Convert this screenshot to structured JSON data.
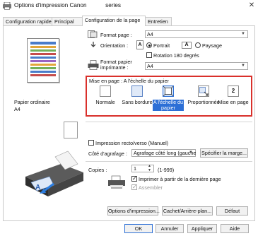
{
  "window": {
    "title": "Options d'impression Canon",
    "title_suffix": "series",
    "close_glyph": "✕",
    "icon": "printer-icon"
  },
  "tabs": [
    {
      "label": "Configuration rapide"
    },
    {
      "label": "Principal"
    },
    {
      "label": "Configuration de la page"
    },
    {
      "label": "Entretien"
    }
  ],
  "preview": {
    "media_type": "Papier ordinaire",
    "media_size": "A4"
  },
  "page_setup": {
    "format_page_label": "Format page :",
    "format_page_value": "A4",
    "orientation_label": "Orientation :",
    "portrait_label": "Portrait",
    "paysage_label": "Paysage",
    "rotation_label": "Rotation 180 degrés",
    "format_papier_label_1": "Format papier",
    "format_papier_label_2": "imprimante :",
    "format_papier_value": "A4"
  },
  "layout": {
    "label": "Mise en page :",
    "selected_name": "A l'échelle du papier",
    "options": [
      {
        "label": "Normale",
        "icon": "normal-page-icon"
      },
      {
        "label": "Sans bordure",
        "icon": "borderless-icon"
      },
      {
        "label_1": "A l'échelle du",
        "label_2": "papier",
        "icon": "fit-to-page-icon"
      },
      {
        "label": "Proportionnée",
        "icon": "scaled-icon"
      },
      {
        "label": "Mise en page",
        "icon": "page-layout-icon",
        "badge": "2"
      }
    ]
  },
  "duplex": {
    "label": "Impression recto/verso (Manuel)",
    "stapling_label": "Côté d'agrafage :",
    "stapling_value": "Agrafage côté long (gauche",
    "margin_button": "Spécifier la marge..."
  },
  "copies": {
    "label": "Copies :",
    "value": "1",
    "range": "(1-999)",
    "last_page_first_label": "Imprimer à partir de la dernière page",
    "collate_label": "Assembler"
  },
  "buttons": {
    "print_options": "Options d'impression...",
    "stamp_background": "Cachet/Arrière-plan...",
    "defaults": "Défaut",
    "ok": "OK",
    "cancel": "Annuler",
    "apply": "Appliquer",
    "help": "Aide"
  },
  "colors": {
    "highlight_border": "#d9302b",
    "selection": "#2c6fd6"
  }
}
